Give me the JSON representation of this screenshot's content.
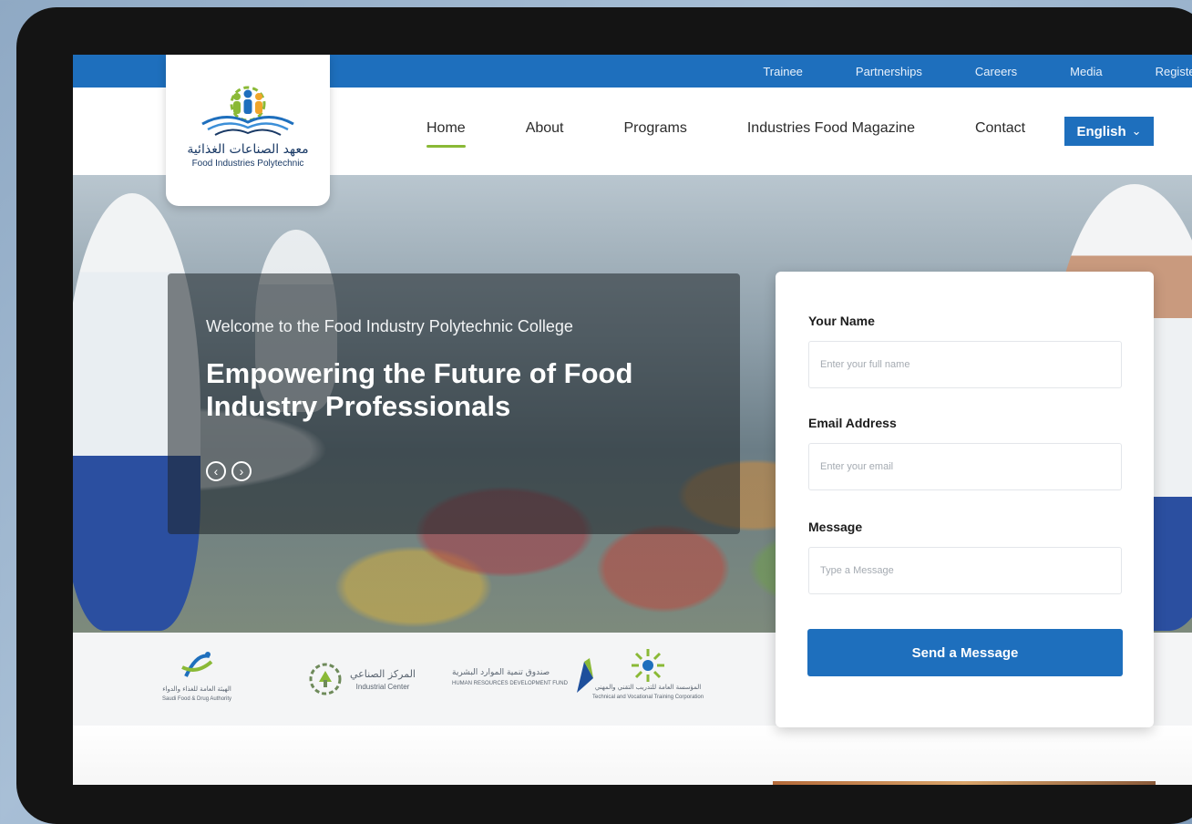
{
  "topbar": {
    "links": [
      "Trainee",
      "Partnerships",
      "Careers",
      "Media",
      "Register"
    ]
  },
  "logo": {
    "arabic": "معهد الصناعات الغذائية",
    "english": "Food Industries Polytechnic"
  },
  "nav": {
    "items": [
      "Home",
      "About",
      "Programs",
      "Industries Food Magazine",
      "Contact"
    ],
    "active": "Home",
    "language": "English"
  },
  "hero": {
    "subtitle": "Welcome to the Food Industry Polytechnic College",
    "title": "Empowering the Future of Food Industry Professionals"
  },
  "form": {
    "name_label": "Your Name",
    "name_placeholder": "Enter your full name",
    "email_label": "Email Address",
    "email_placeholder": "Enter your email",
    "message_label": "Message",
    "message_placeholder": "Type a Message",
    "submit_label": "Send a Message"
  },
  "partners": [
    {
      "ar": "الهيئة العامة للغذاء والدواء",
      "en": "Saudi Food & Drug Authority"
    },
    {
      "ar": "المركز الصناعي",
      "en": "Industrial Center"
    },
    {
      "ar": "صندوق تنمية الموارد البشرية",
      "en": "HUMAN RESOURCES DEVELOPMENT FUND"
    },
    {
      "ar": "المؤسسة العامة للتدريب التقني والمهني",
      "en": "Technical and Vocational Training Corporation"
    }
  ],
  "colors": {
    "primary": "#1e6fbd",
    "accent": "#8ab936",
    "device_bezel": "#141414"
  }
}
